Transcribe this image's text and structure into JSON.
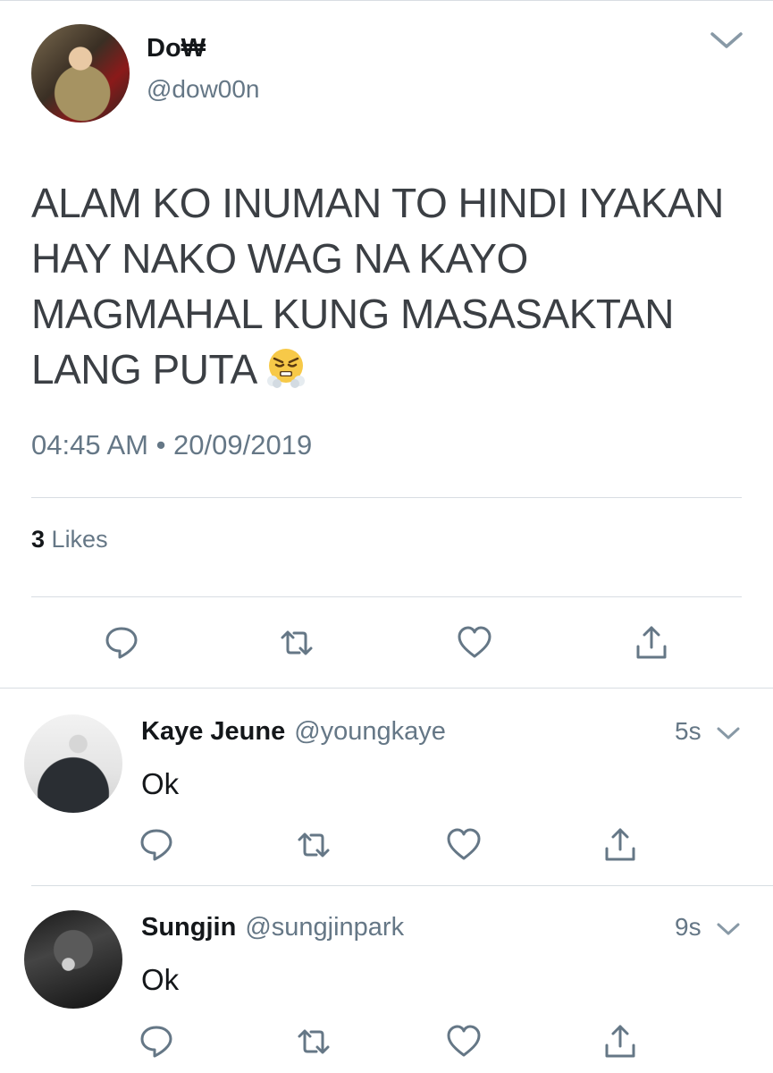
{
  "main_tweet": {
    "display_name": "Do₩",
    "handle": "@dow00n",
    "text": "ALAM KO INUMAN TO HINDI IYAKAN HAY NAKO WAG NA KAYO MAGMAHAL KUNG MASASAKTAN LANG PUTA",
    "emoji_icon": "face-with-steam-from-nose-icon",
    "timestamp": "04:45 AM • 20/09/2019",
    "likes_count": "3",
    "likes_label": "Likes"
  },
  "replies": [
    {
      "display_name": "Kaye Jeune",
      "handle": "@youngkaye",
      "time": "5s",
      "text": "Ok"
    },
    {
      "display_name": "Sungjin",
      "handle": "@sungjinpark",
      "time": "9s",
      "text": "Ok"
    }
  ],
  "colors": {
    "icon_gray": "#657786",
    "divider": "#d8dde2",
    "text_dark": "#14171a"
  }
}
